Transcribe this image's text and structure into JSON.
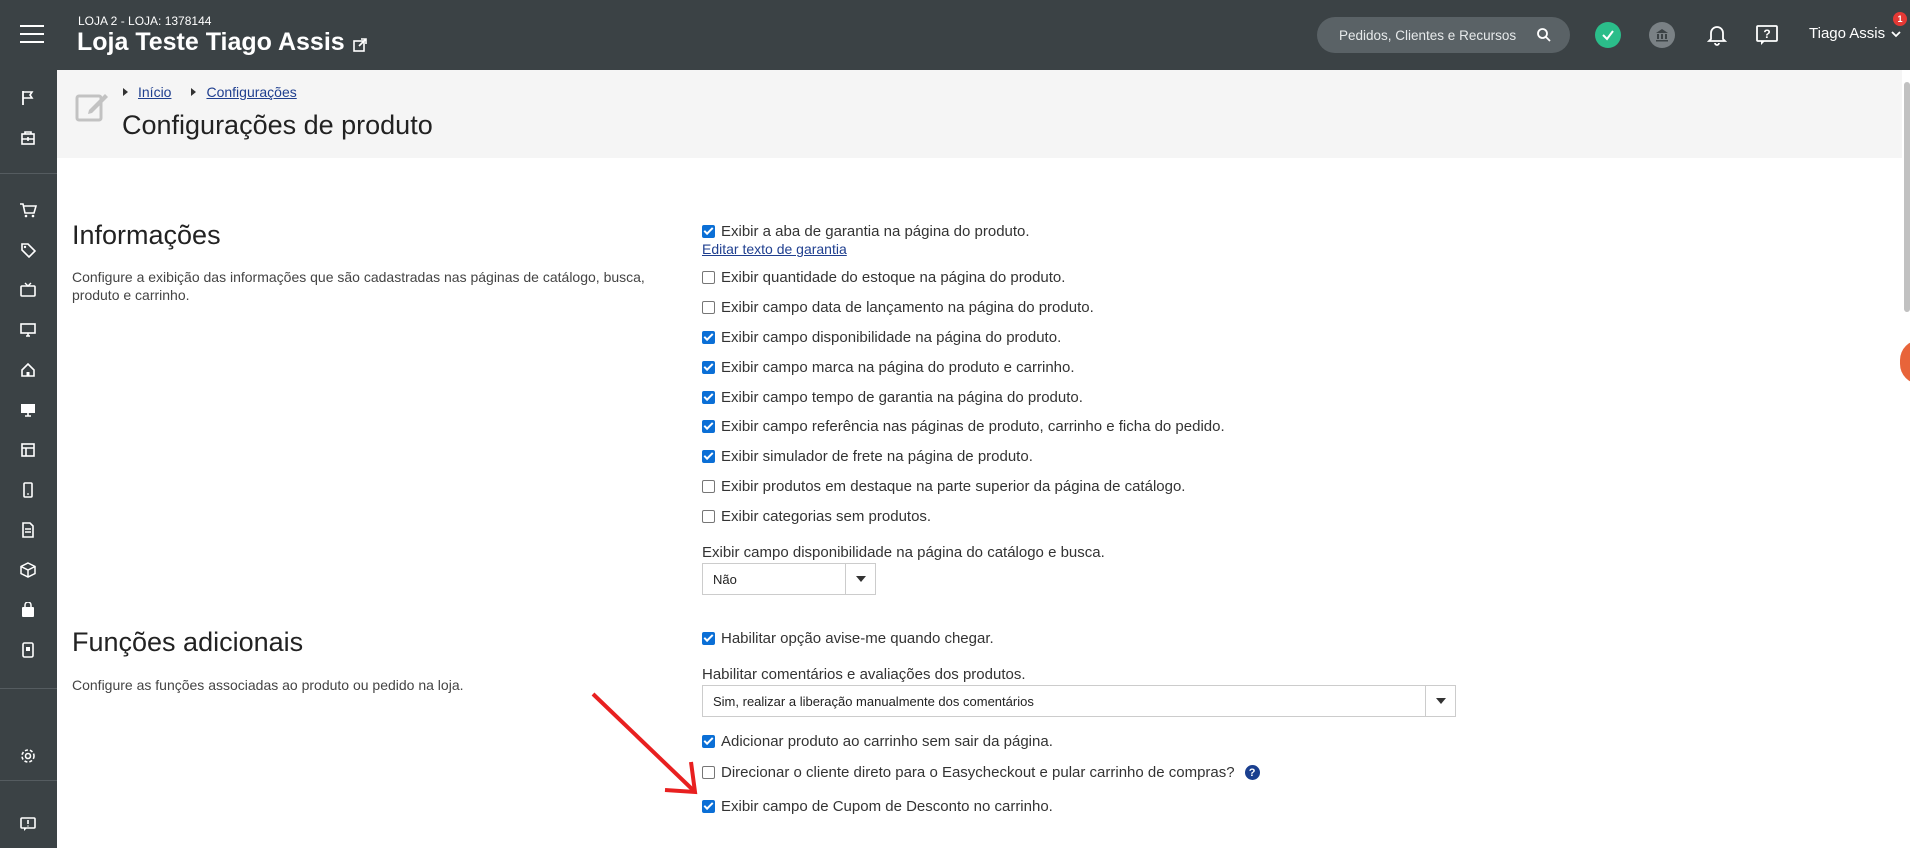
{
  "topbar": {
    "store_sub": "LOJA 2 - LOJA: 1378144",
    "store_name": "Loja Teste Tiago Assis",
    "search_placeholder": "Pedidos, Clientes e Recursos",
    "user_name": "Tiago Assis",
    "notification_count": "1"
  },
  "breadcrumb": {
    "items": [
      "Início",
      "Configurações"
    ]
  },
  "page": {
    "title": "Configurações de produto"
  },
  "informacoes": {
    "title": "Informações",
    "description": "Configure a exibição das informações que são cadastradas nas páginas de catálogo, busca, produto e carrinho.",
    "options": [
      {
        "label": "Exibir a aba de garantia na página do produto.",
        "checked": true
      },
      {
        "label": "Exibir quantidade do estoque na página do produto.",
        "checked": false
      },
      {
        "label": "Exibir campo data de lançamento na página do produto.",
        "checked": false
      },
      {
        "label": "Exibir campo disponibilidade na página do produto.",
        "checked": true
      },
      {
        "label": "Exibir campo marca na página do produto e carrinho.",
        "checked": true
      },
      {
        "label": "Exibir campo tempo de garantia na página do produto.",
        "checked": true
      },
      {
        "label": "Exibir campo referência nas páginas de produto, carrinho e ficha do pedido.",
        "checked": true
      },
      {
        "label": "Exibir simulador de frete na página de produto.",
        "checked": true
      },
      {
        "label": "Exibir produtos em destaque na parte superior da página de catálogo.",
        "checked": false
      },
      {
        "label": "Exibir categorias sem produtos.",
        "checked": false
      }
    ],
    "edit_link": "Editar texto de garantia",
    "availability_label": "Exibir campo disponibilidade na página do catálogo e busca.",
    "availability_value": "Não"
  },
  "funcoes": {
    "title": "Funções adicionais",
    "description": "Configure as funções associadas ao produto ou pedido na loja.",
    "opt_notify": {
      "label": "Habilitar opção avise-me quando chegar.",
      "checked": true
    },
    "comments_label": "Habilitar comentários e avaliações dos produtos.",
    "comments_value": "Sim, realizar a liberação manualmente dos comentários",
    "opt_add_cart": {
      "label": "Adicionar produto ao carrinho sem sair da página.",
      "checked": true
    },
    "opt_easycheckout": {
      "label": "Direcionar o cliente direto para o Easycheckout e pular carrinho de compras?",
      "checked": false
    },
    "opt_coupon": {
      "label": "Exibir campo de Cupom de Desconto no carrinho.",
      "checked": true
    }
  },
  "colors": {
    "topbar": "#3b4245",
    "accent_blue": "#0b6fd6",
    "link": "#1f3f8f",
    "ok_green": "#2bbd8a",
    "annotation_red": "#e82020"
  },
  "icons": {
    "sidebar": [
      "flag-icon",
      "dashboard-icon",
      "cart-icon",
      "tag-icon",
      "tv-icon",
      "monitor-icon",
      "home-icon",
      "desktop-icon",
      "layout-icon",
      "mobile-icon",
      "document-icon",
      "box-icon",
      "bag-icon",
      "device-icon",
      "settings-icon",
      "feedback-icon"
    ]
  }
}
